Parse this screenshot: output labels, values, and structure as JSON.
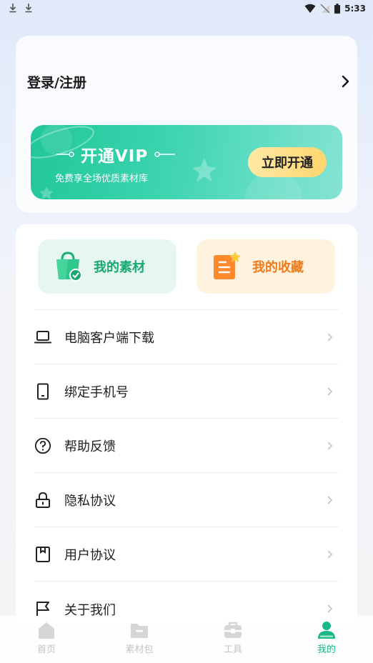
{
  "status": {
    "time": "5:33"
  },
  "login": {
    "label": "登录/注册"
  },
  "vip": {
    "title": "开通VIP",
    "subtitle": "免费享全场优质素材库",
    "button": "立即开通"
  },
  "quick": {
    "material": "我的素材",
    "favorites": "我的收藏"
  },
  "menu": [
    {
      "label": "电脑客户端下载",
      "icon": "laptop-icon"
    },
    {
      "label": "绑定手机号",
      "icon": "phone-icon"
    },
    {
      "label": "帮助反馈",
      "icon": "question-icon"
    },
    {
      "label": "隐私协议",
      "icon": "lock-icon"
    },
    {
      "label": "用户协议",
      "icon": "bookmark-icon"
    },
    {
      "label": "关于我们",
      "icon": "flag-icon"
    }
  ],
  "nav": [
    {
      "label": "首页",
      "icon": "home-icon"
    },
    {
      "label": "素材包",
      "icon": "folder-icon"
    },
    {
      "label": "工具",
      "icon": "toolbox-icon"
    },
    {
      "label": "我的",
      "icon": "profile-icon",
      "active": true
    }
  ],
  "colors": {
    "brand": "#19b886",
    "vip_button": "#ffd56e",
    "favorites_bg": "#fff3df",
    "material_bg": "#e6f7ef"
  }
}
